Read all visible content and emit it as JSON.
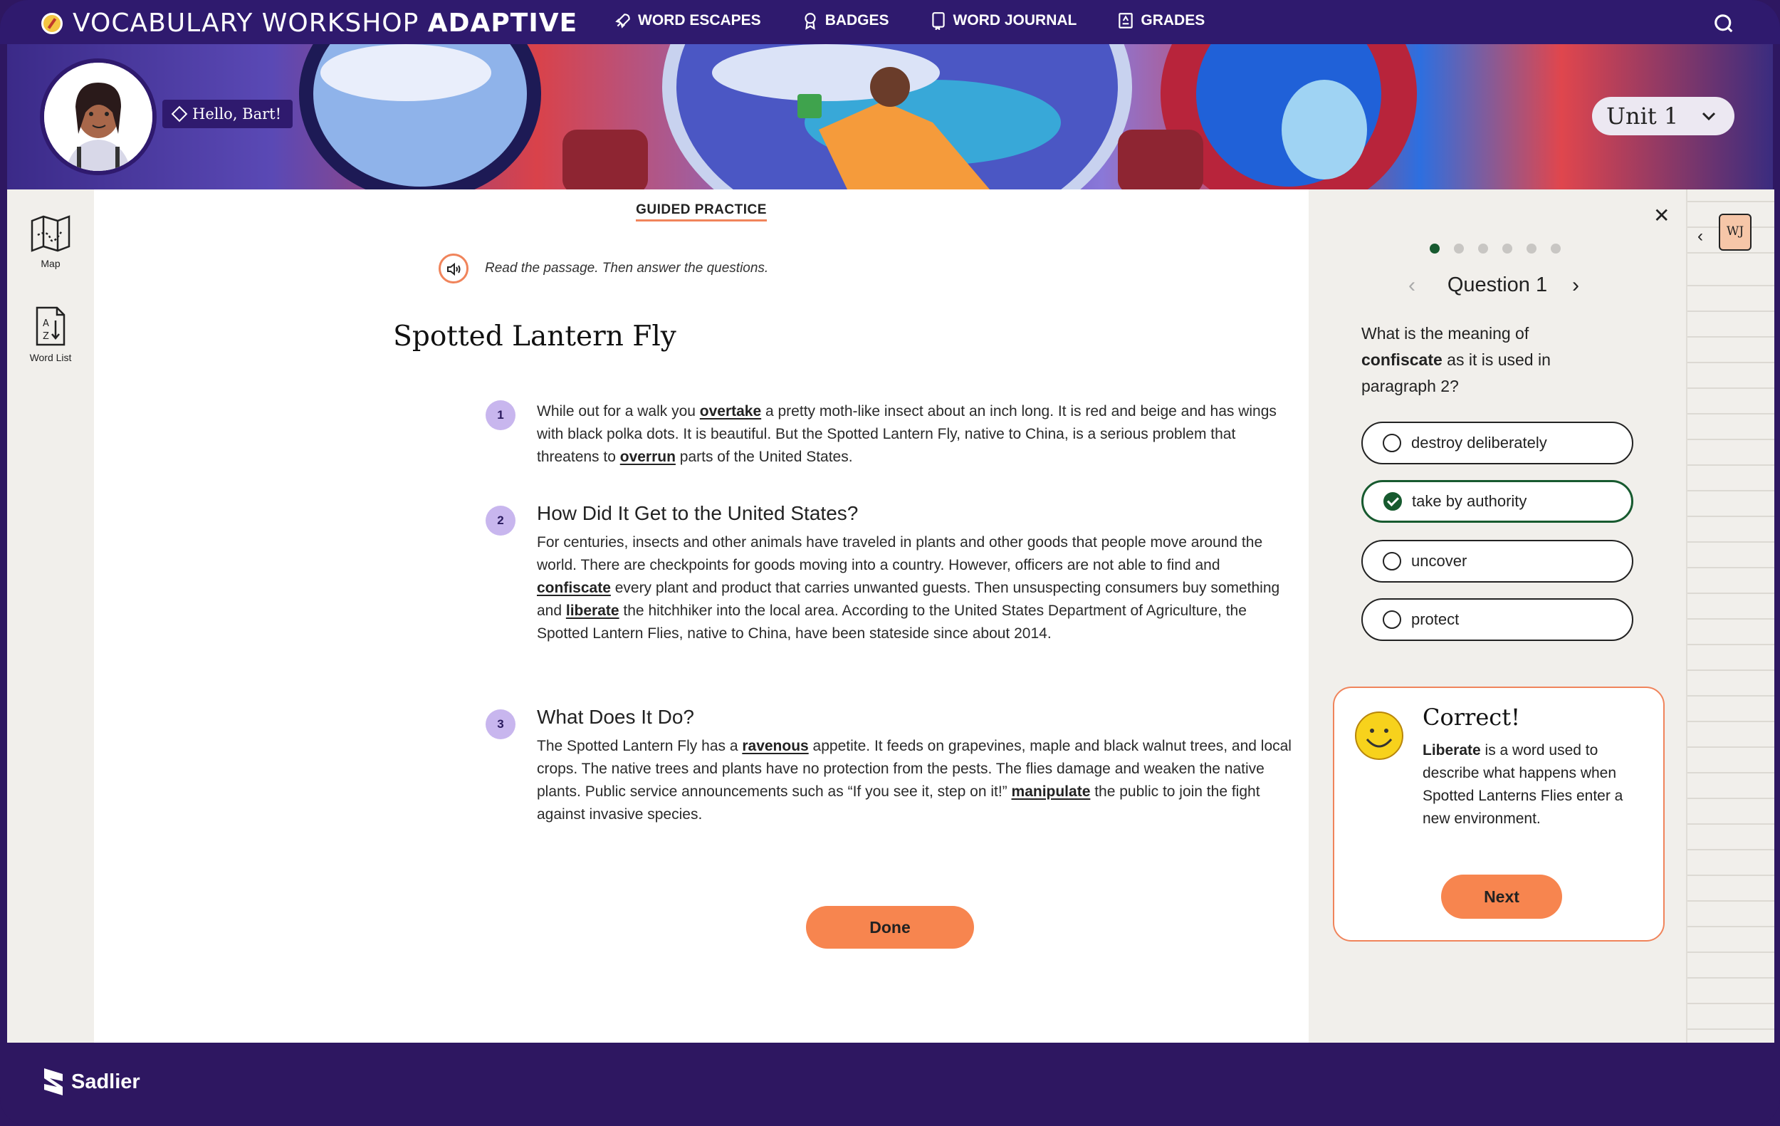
{
  "header": {
    "brand_main": "VOCABULARY WORKSHOP",
    "brand_bold": "ADAPTIVE",
    "nav": [
      {
        "label": "WORD ESCAPES",
        "icon": "rocket-icon"
      },
      {
        "label": "BADGES",
        "icon": "badge-icon"
      },
      {
        "label": "WORD JOURNAL",
        "icon": "journal-icon"
      },
      {
        "label": "GRADES",
        "icon": "grades-icon"
      }
    ],
    "search_icon": "search-icon"
  },
  "banner": {
    "greeting": "Hello, Bart!",
    "unit": "Unit 1"
  },
  "left_rail": {
    "items": [
      {
        "label": "Map",
        "icon": "map-icon"
      },
      {
        "label": "Word List",
        "icon": "word-list-icon"
      }
    ]
  },
  "passage": {
    "section_label": "GUIDED PRACTICE",
    "instruction": "Read the passage. Then answer the questions.",
    "title": "Spotted Lantern Fly",
    "paragraphs": [
      {
        "number": "1",
        "heading": "",
        "segments": [
          "While out for a walk you ",
          "overtake",
          " a pretty moth-like insect about an inch long. It is red and beige and has wings with black polka dots. It is beautiful. But the Spotted Lantern Fly, native to China, is a serious problem that threatens to ",
          "overrun",
          " parts of the United States."
        ]
      },
      {
        "number": "2",
        "heading": "How Did It Get to the United States?",
        "segments": [
          "For centuries, insects and other animals have traveled in plants and other goods that people move around the world. There are checkpoints for goods moving into a country. However, officers are not able to find and ",
          "confiscate",
          " every plant and product that carries unwanted guests. Then unsuspecting consumers buy something and ",
          "liberate",
          " the hitchhiker into the local area. According to the United States Department of Agriculture, the Spotted Lantern Flies, native to China, have been stateside since about 2014."
        ]
      },
      {
        "number": "3",
        "heading": "What Does It Do?",
        "segments": [
          "The Spotted Lantern Fly has a ",
          "ravenous",
          " appetite. It feeds on grapevines, maple and black walnut trees, and local crops. The native trees and plants have no protection from the pests. The flies damage and weaken the native plants. Public service announcements such as “If you see it, step on it!” ",
          "manipulate",
          " the public to join the fight against invasive species."
        ]
      }
    ],
    "done_label": "Done"
  },
  "question_panel": {
    "question_count": 6,
    "current_index": 0,
    "question_title": "Question 1",
    "question_pre": "What is the meaning of ",
    "question_word": "confiscate",
    "question_post": " as it is used in paragraph 2?",
    "options": [
      {
        "label": "destroy deliberately",
        "selected": false
      },
      {
        "label": "take by authority",
        "selected": true
      },
      {
        "label": "uncover",
        "selected": false
      },
      {
        "label": "protect",
        "selected": false
      }
    ],
    "feedback": {
      "title": "Correct!",
      "word": "Liberate",
      "text": " is a word used to describe what happens when Spotted Lanterns Flies enter a new environment.",
      "next_label": "Next"
    }
  },
  "journal": {
    "badge": "WJ"
  },
  "footer": {
    "logo_text": "Sadlier"
  },
  "colors": {
    "nav_bg": "#2f1a6e",
    "accent_orange": "#f7854f",
    "correct_green": "#175a2f",
    "number_badge": "#c8b6ee"
  }
}
